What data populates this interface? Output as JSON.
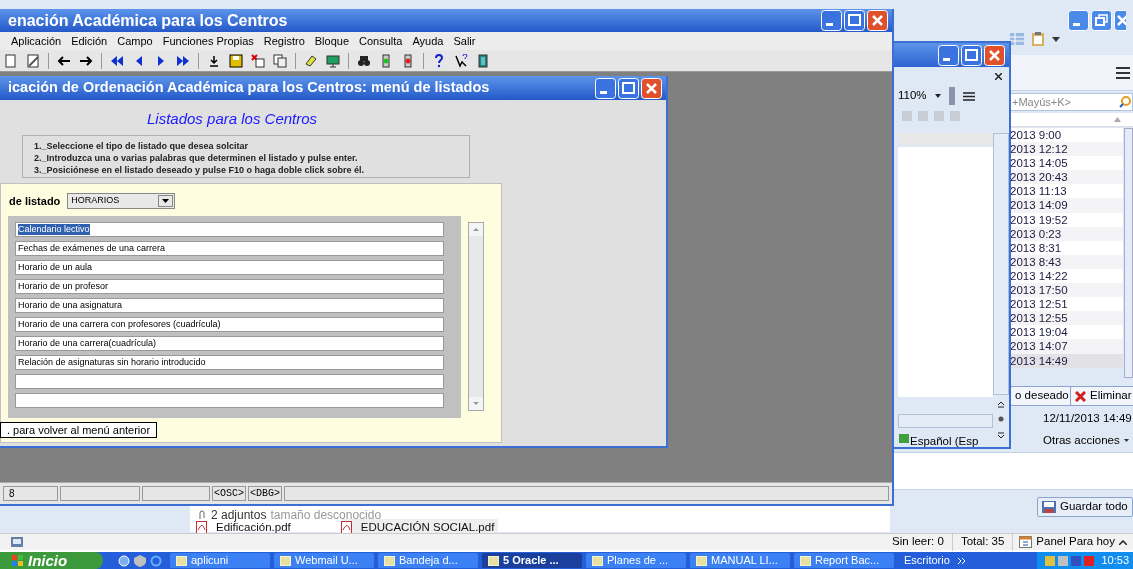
{
  "outlook": {
    "search_placeholder": "+Mayús+K>",
    "messages": [
      {
        "date": "2013 9:00",
        "selected": false
      },
      {
        "date": "2013 12:12",
        "selected": false
      },
      {
        "date": "2013 14:05",
        "selected": false
      },
      {
        "date": "2013 20:43",
        "selected": false
      },
      {
        "date": "2013 11:13",
        "selected": false
      },
      {
        "date": "2013 14:09",
        "selected": false
      },
      {
        "date": "2013 19:52",
        "selected": false
      },
      {
        "date": "2013 0:23",
        "selected": false
      },
      {
        "date": "2013 8:31",
        "selected": false
      },
      {
        "date": "2013 8:43",
        "selected": false
      },
      {
        "date": "2013 14:22",
        "selected": false
      },
      {
        "date": "2013 17:50",
        "selected": false
      },
      {
        "date": "2013 12:51",
        "selected": false
      },
      {
        "date": "2013 12:55",
        "selected": false
      },
      {
        "date": "2013 19:04",
        "selected": false
      },
      {
        "date": "2013 14:07",
        "selected": false
      },
      {
        "date": "2013 14:49",
        "selected": true
      }
    ],
    "wish_button": "o deseado",
    "delete_button": "Eliminar",
    "received": "12/11/2013 14:49",
    "more_actions": "Otras acciones",
    "attachments_summary": "2 adjuntos",
    "attachments_size": "tamaño desconocido",
    "attachments": [
      "Edificación.pdf",
      "EDUCACIÓN SOCIAL.pdf"
    ],
    "save_all": "Guardar todo",
    "status": [
      "Sin leer: 0",
      "Total: 35"
    ],
    "today_panel": "Panel Para hoy"
  },
  "word": {
    "zoom": "110%",
    "language": "Español (Esp"
  },
  "oracle": {
    "title": "enación Académica para los Centros",
    "menu": [
      "Aplicación",
      "Edición",
      "Campo",
      "Funciones Propias",
      "Registro",
      "Bloque",
      "Consulta",
      "Ayuda",
      "Salir"
    ],
    "status_bar": {
      "record": "8",
      "flags": [
        "<OSC>",
        "<DBG>"
      ]
    }
  },
  "listados": {
    "title": "icación de Ordenación Académica para los Centros: menú de listados",
    "heading": "Listados para los Centros",
    "instructions": [
      "1._Seleccione el tipo de listado que desea solcitar",
      "2._Introduzca una o varias palabras que determinen el listado y pulse enter.",
      "3._Posiciónese en el listado deseado y pulse F10 o haga doble click sobre él."
    ],
    "type_label": "de listado",
    "type_value": "HORARIOS",
    "items": [
      {
        "text": "Calendario lectivo",
        "selected": true
      },
      {
        "text": "Fechas de exámenes de una carrera",
        "selected": false
      },
      {
        "text": "Horario de un aula",
        "selected": false
      },
      {
        "text": "Horario de un profesor",
        "selected": false
      },
      {
        "text": "Horario de una asignatura",
        "selected": false
      },
      {
        "text": "Horario de una carrera con profesores (cuadrícula)",
        "selected": false
      },
      {
        "text": "Horario de una carrera(cuadrícula)",
        "selected": false
      },
      {
        "text": "Relación de asignaturas sin horario introducido",
        "selected": false
      }
    ],
    "back_hint": ". para volver al menú anterior"
  },
  "taskbar": {
    "start": "Inicio",
    "tasks": [
      {
        "label": "aplicuni",
        "selected": false
      },
      {
        "label": "Webmail U...",
        "selected": false
      },
      {
        "label": "Bandeja d...",
        "selected": false
      },
      {
        "label": "5 Oracle ...",
        "selected": true
      },
      {
        "label": "Planes de ...",
        "selected": false
      },
      {
        "label": "MANUAL LI...",
        "selected": false
      },
      {
        "label": "Report Bac...",
        "selected": false
      }
    ],
    "desktop": "Escritorio",
    "clock": "10:53"
  }
}
